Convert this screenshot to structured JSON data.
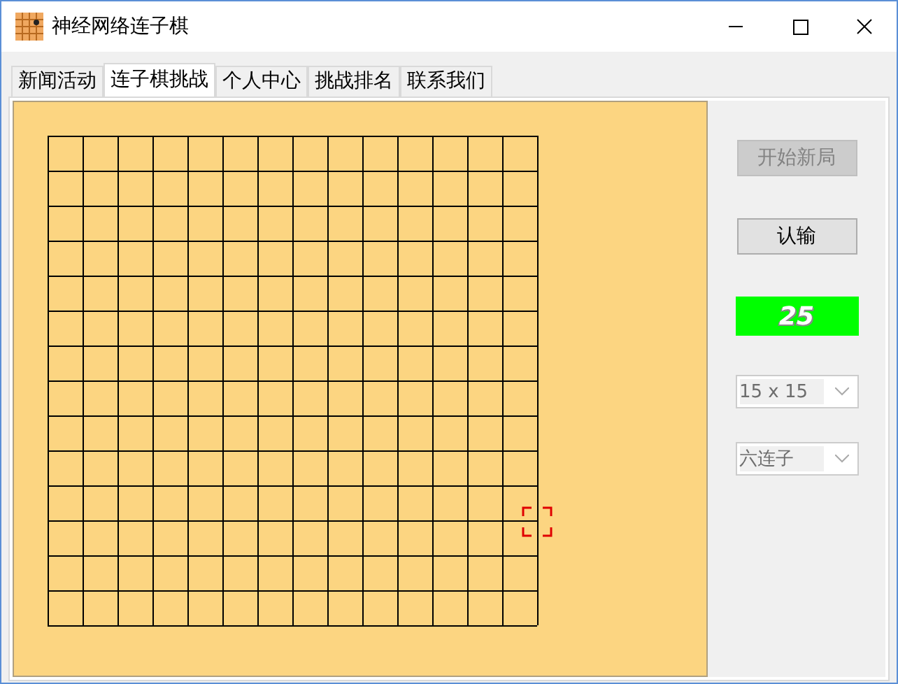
{
  "window": {
    "title": "神经网络连子棋"
  },
  "tabs": [
    {
      "label": "新闻活动",
      "selected": false
    },
    {
      "label": "连子棋挑战",
      "selected": true
    },
    {
      "label": "个人中心",
      "selected": false
    },
    {
      "label": "挑战排名",
      "selected": false
    },
    {
      "label": "联系我们",
      "selected": false
    }
  ],
  "buttons": [
    {
      "label": "开始新局",
      "disabled": true
    },
    {
      "label": "认输",
      "disabled": false
    }
  ],
  "timer": "25",
  "dropdowns": [
    {
      "value": "15 x 15",
      "disabled": true
    },
    {
      "value": "六连子",
      "disabled": true
    }
  ]
}
